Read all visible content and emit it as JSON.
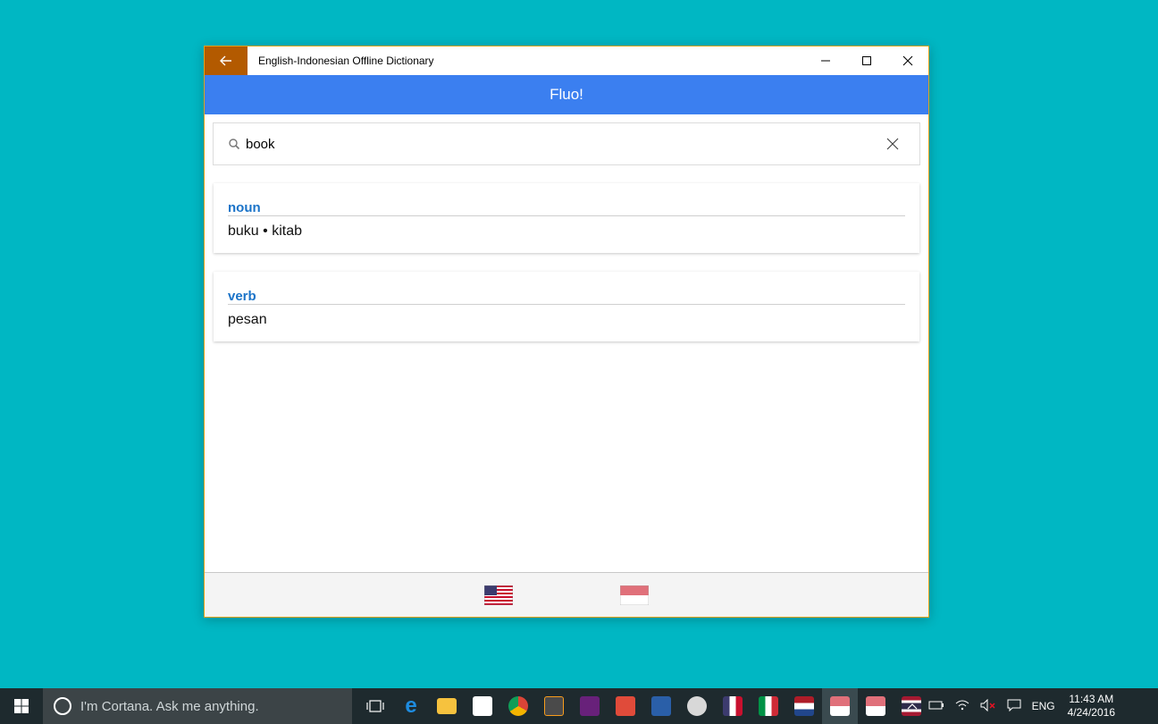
{
  "window": {
    "title": "English-Indonesian Offline Dictionary"
  },
  "app": {
    "header_title": "Fluo!"
  },
  "search": {
    "value": "book",
    "placeholder": ""
  },
  "results": [
    {
      "part_of_speech": "noun",
      "translation": "buku • kitab"
    },
    {
      "part_of_speech": "verb",
      "translation": "pesan"
    }
  ],
  "language_switch": {
    "source_flag": "us-flag-icon",
    "target_flag": "indonesia-flag-icon"
  },
  "taskbar": {
    "cortana_placeholder": "I'm Cortana. Ask me anything.",
    "language": "ENG",
    "time": "11:43 AM",
    "date": "4/24/2016"
  },
  "colors": {
    "desktop": "#00b7c3",
    "app_header": "#3b7ff0",
    "back_button": "#b35a00",
    "part_of_speech": "#1a73c8",
    "window_border": "#e3a21a"
  }
}
